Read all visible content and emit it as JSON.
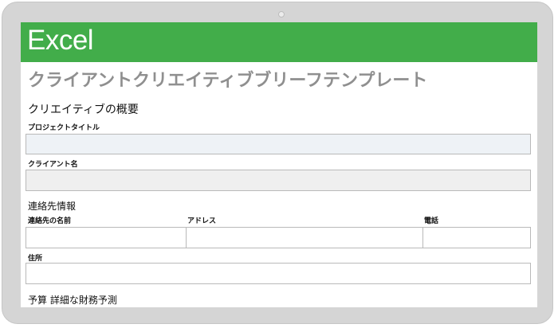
{
  "app": {
    "name": "Excel"
  },
  "document": {
    "title": "クライアントクリエイティブブリーフテンプレート"
  },
  "creative_overview": {
    "heading": "クリエイティブの概要",
    "project_title_label": "プロジェクトタイトル",
    "project_title_value": "",
    "client_name_label": "クライアント名",
    "client_name_value": ""
  },
  "contact_info": {
    "heading": "連絡先情報",
    "contact_name_label": "連絡先の名前",
    "address_label": "アドレス",
    "phone_label": "電話",
    "residence_label": "住所"
  },
  "budget": {
    "heading": "予算 詳細な財務予測"
  },
  "colors": {
    "banner": "#42ad4a",
    "title": "#8f8f8f"
  }
}
